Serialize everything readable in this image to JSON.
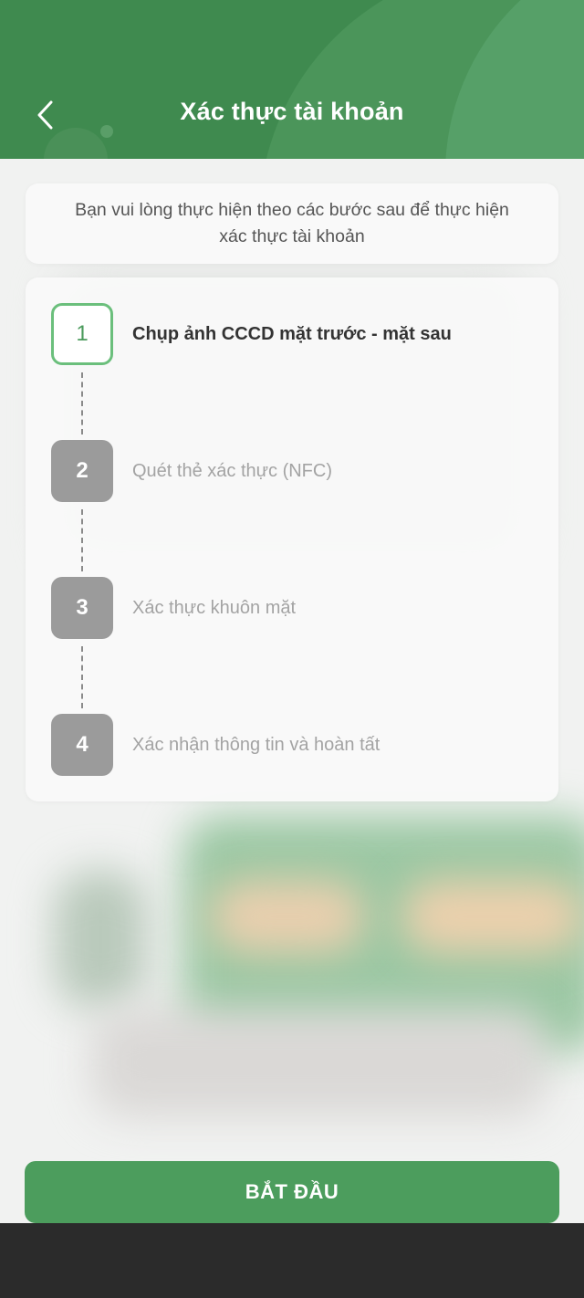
{
  "header": {
    "title": "Xác thực tài khoản",
    "back_icon": "chevron-left-icon"
  },
  "intro": {
    "text": "Bạn vui lòng thực hiện theo các bước sau để thực hiện xác thực tài khoản"
  },
  "steps": [
    {
      "number": "1",
      "label": "Chụp ảnh CCCD mặt trước - mặt sau",
      "state": "active"
    },
    {
      "number": "2",
      "label": "Quét thẻ xác thực (NFC)",
      "state": "inactive"
    },
    {
      "number": "3",
      "label": "Xác thực khuôn mặt",
      "state": "inactive"
    },
    {
      "number": "4",
      "label": "Xác nhận thông tin và hoàn tất",
      "state": "inactive"
    }
  ],
  "actions": {
    "start_label": "BẮT ĐẦU"
  },
  "colors": {
    "primary": "#4c9d5d",
    "header": "#3f8a4f",
    "active_border": "#6bbf7c",
    "inactive_step": "#9b9b9b"
  }
}
